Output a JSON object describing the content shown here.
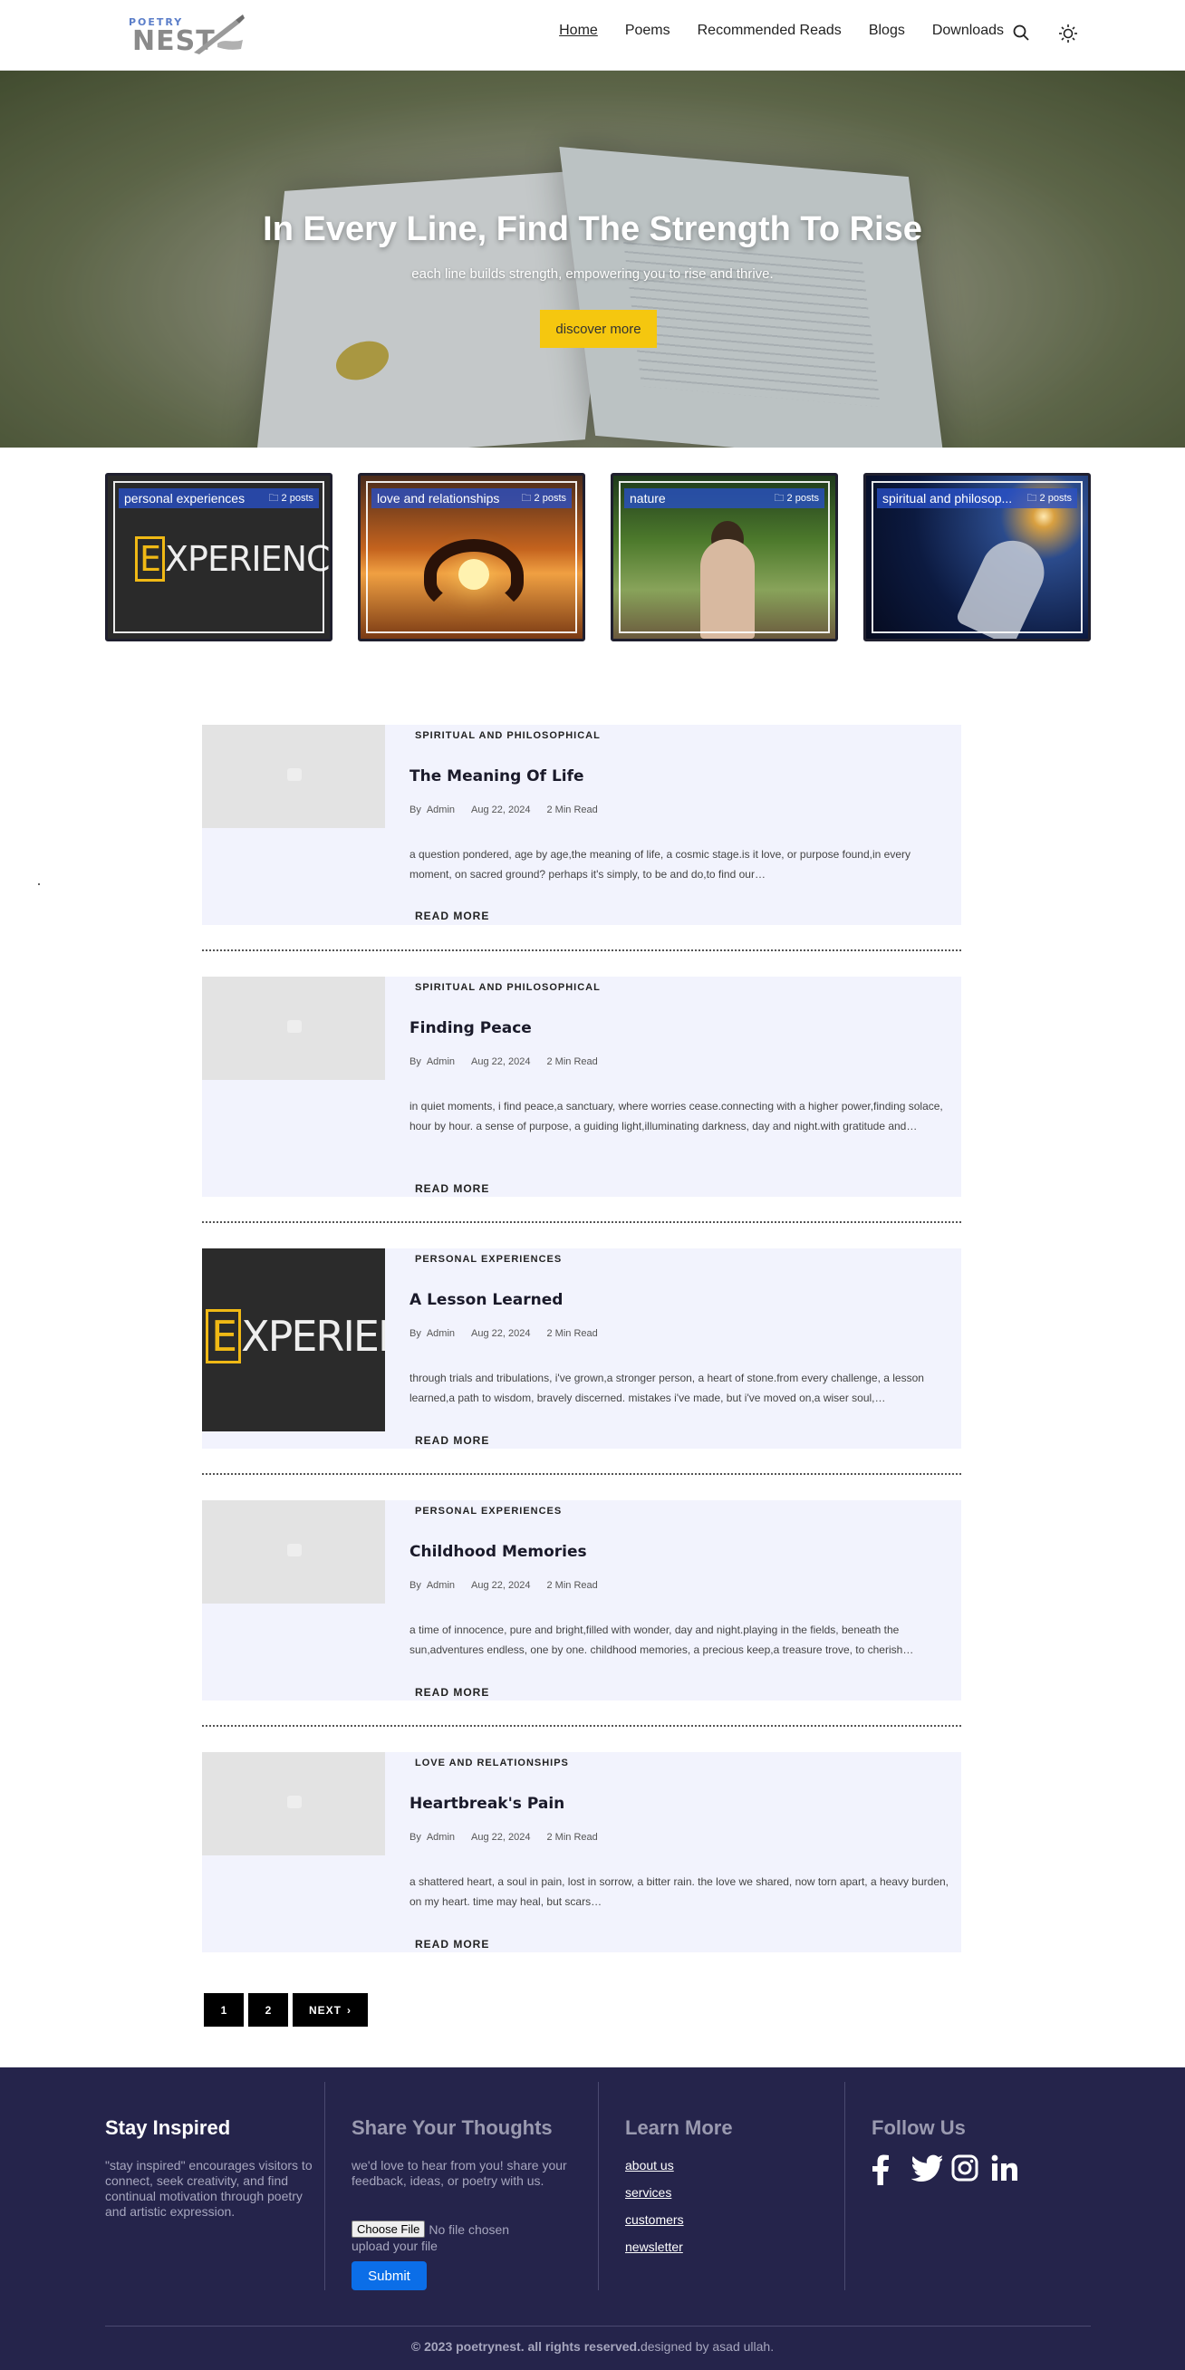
{
  "header": {
    "logo_top": "POETRY",
    "logo_main": "NEST",
    "nav": [
      "Home",
      "Poems",
      "Recommended Reads",
      "Blogs",
      "Downloads"
    ],
    "icons": [
      "search-icon",
      "sun-icon"
    ]
  },
  "hero": {
    "title": "In Every Line, Find The Strength To Rise",
    "subtitle": "each line builds strength, empowering you to rise and thrive.",
    "button": "discover more"
  },
  "categories": [
    {
      "name": "personal experiences",
      "count": "2 posts"
    },
    {
      "name": "love and relationships",
      "count": "2 posts"
    },
    {
      "name": "nature",
      "count": "2 posts"
    },
    {
      "name": "spiritual and philosop...",
      "count": "2 posts"
    }
  ],
  "category_image_text": "EXPERIENCE",
  "posts": [
    {
      "category": "SPIRITUAL AND PHILOSOPHICAL",
      "title": "The Meaning Of Life",
      "by": "By",
      "author": "Admin",
      "date": "Aug 22, 2024",
      "read": "2 Min Read",
      "excerpt": "a question pondered, age by age,the meaning of life, a cosmic stage.is it love, or purpose found,in every moment, on sacred ground? perhaps it's simply, to be and do,to find our…",
      "readmore": "READ MORE"
    },
    {
      "category": "SPIRITUAL AND PHILOSOPHICAL",
      "title": "Finding Peace",
      "by": "By",
      "author": "Admin",
      "date": "Aug 22, 2024",
      "read": "2 Min Read",
      "excerpt": "in quiet moments, i find peace,a sanctuary, where worries cease.connecting with a higher power,finding solace, hour by hour. a sense of purpose, a guiding light,illuminating darkness, day and night.with gratitude and…",
      "readmore": "READ MORE"
    },
    {
      "category": "PERSONAL EXPERIENCES",
      "title": "A Lesson Learned",
      "by": "By",
      "author": "Admin",
      "date": "Aug 22, 2024",
      "read": "2 Min Read",
      "excerpt": "through trials and tribulations, i've grown,a stronger person, a heart of stone.from every challenge, a lesson learned,a path to wisdom, bravely discerned. mistakes i've made, but i've moved on,a wiser soul,…",
      "readmore": "READ MORE"
    },
    {
      "category": "PERSONAL EXPERIENCES",
      "title": "Childhood Memories",
      "by": "By",
      "author": "Admin",
      "date": "Aug 22, 2024",
      "read": "2 Min Read",
      "excerpt": "a time of innocence, pure and bright,filled with wonder, day and night.playing in the fields, beneath the sun,adventures endless, one by one. childhood memories, a precious keep,a treasure trove, to cherish…",
      "readmore": "READ MORE"
    },
    {
      "category": "LOVE AND RELATIONSHIPS",
      "title": "Heartbreak's Pain",
      "by": "By",
      "author": "Admin",
      "date": "Aug 22, 2024",
      "read": "2 Min Read",
      "excerpt": "a shattered heart, a soul in pain, lost in sorrow, a bitter rain. the love we shared, now torn apart, a heavy burden, on my heart. time may heal, but scars…",
      "readmore": "READ MORE"
    }
  ],
  "pagination": {
    "pages": [
      "1",
      "2"
    ],
    "next": "NEXT"
  },
  "footer": {
    "col1": {
      "title": "Stay Inspired",
      "text": "\"stay inspired\" encourages visitors to connect, seek creativity, and find continual motivation through poetry and artistic expression."
    },
    "col2": {
      "title": "Share Your Thoughts",
      "text": "we'd love to hear from you! share your feedback, ideas, or poetry with us.",
      "choose": "Choose File",
      "nofile": "No file chosen",
      "upload": "upload your file",
      "submit": "Submit"
    },
    "col3": {
      "title": "Learn More",
      "links": [
        "about us",
        "services",
        "customers",
        "newsletter"
      ]
    },
    "col4": {
      "title": "Follow Us",
      "icons": [
        "facebook-icon",
        "twitter-icon",
        "instagram-icon",
        "linkedin-icon"
      ]
    },
    "copyright_bold": "© 2023 poetrynest. all rights reserved.",
    "copyright_rest": "designed by asad ullah."
  }
}
